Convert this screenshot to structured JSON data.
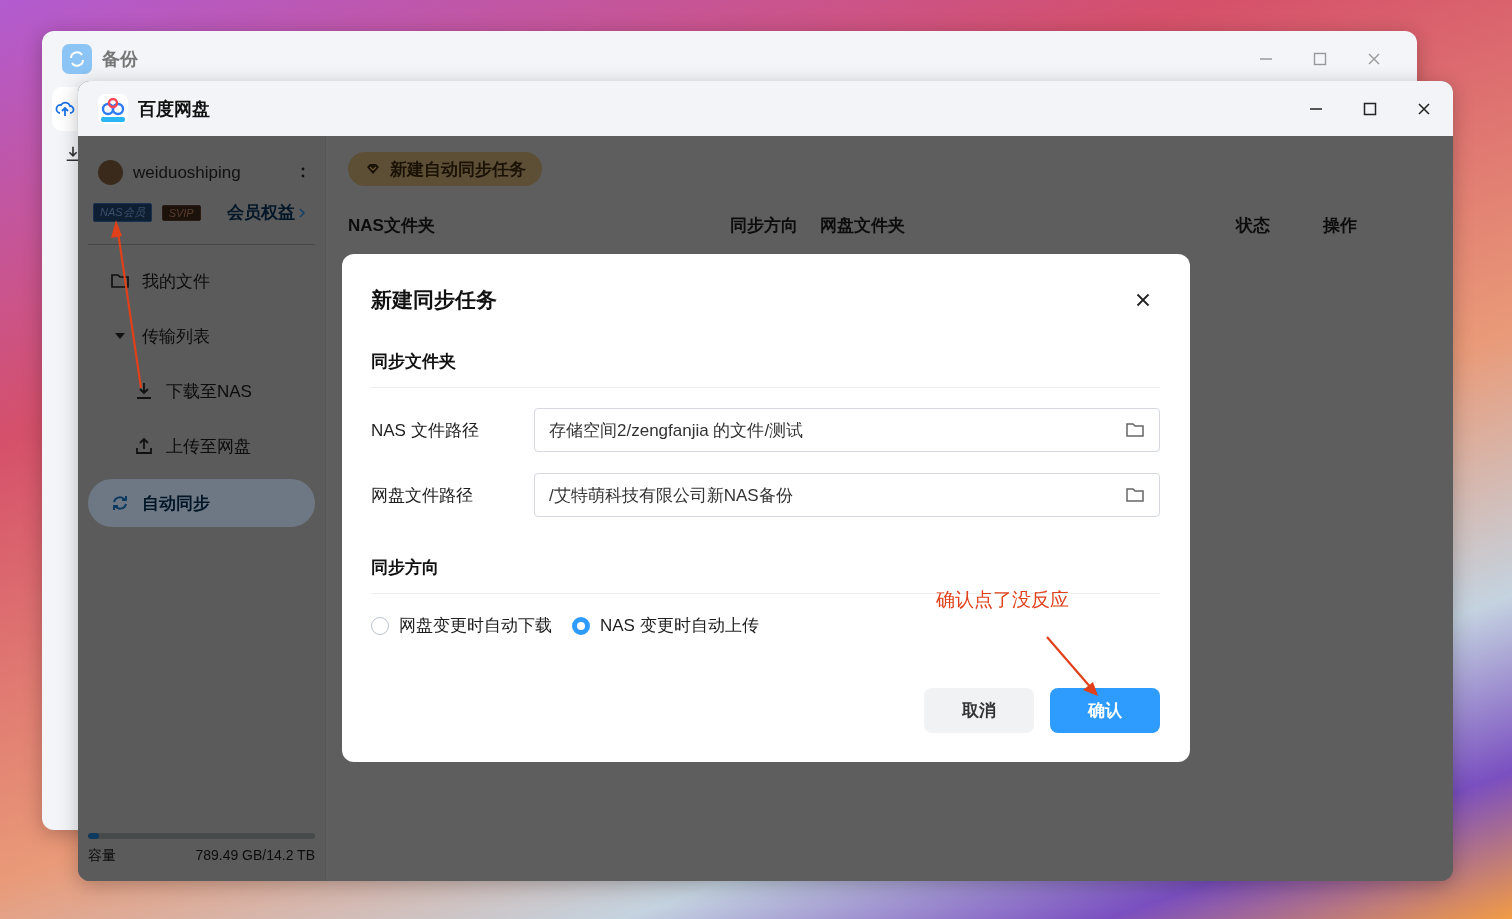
{
  "back_window": {
    "title": "备份"
  },
  "window": {
    "title": "百度网盘"
  },
  "user": {
    "name": "weiduoshiping",
    "badges": [
      {
        "label": "NAS会员",
        "kind": "nas"
      },
      {
        "label": "SVIP",
        "kind": "svip"
      }
    ],
    "benefits_link": "会员权益"
  },
  "sidebar": {
    "items": [
      {
        "label": "我的文件",
        "kind": "files",
        "selected": false
      },
      {
        "label": "传输列表",
        "kind": "group",
        "expanded": true,
        "selected": false,
        "children": [
          {
            "label": "下载至NAS",
            "kind": "download",
            "selected": false
          },
          {
            "label": "上传至网盘",
            "kind": "upload",
            "selected": false
          }
        ]
      },
      {
        "label": "自动同步",
        "kind": "sync",
        "selected": true
      }
    ]
  },
  "storage": {
    "label": "容量",
    "usage": "789.49 GB/14.2 TB",
    "level": 0.05
  },
  "toolbar": {
    "new_task_button": "新建自动同步任务"
  },
  "table": {
    "columns": [
      "NAS文件夹",
      "同步方向",
      "网盘文件夹",
      "状态",
      "操作"
    ]
  },
  "dialog": {
    "title": "新建同步任务",
    "section_folders": "同步文件夹",
    "fields": [
      {
        "label": "NAS 文件路径",
        "value": "存储空间2/zengfanjia 的文件/测试"
      },
      {
        "label": "网盘文件路径",
        "value": "/艾特萌科技有限公司新NAS备份"
      }
    ],
    "section_direction": "同步方向",
    "direction_options": [
      {
        "label": "网盘变更时自动下载",
        "selected": false
      },
      {
        "label": "NAS 变更时自动上传",
        "selected": true
      }
    ],
    "buttons": [
      {
        "label": "取消",
        "kind": "secondary"
      },
      {
        "label": "确认",
        "kind": "primary"
      }
    ]
  },
  "annotation": {
    "text": "确认点了没反应"
  }
}
